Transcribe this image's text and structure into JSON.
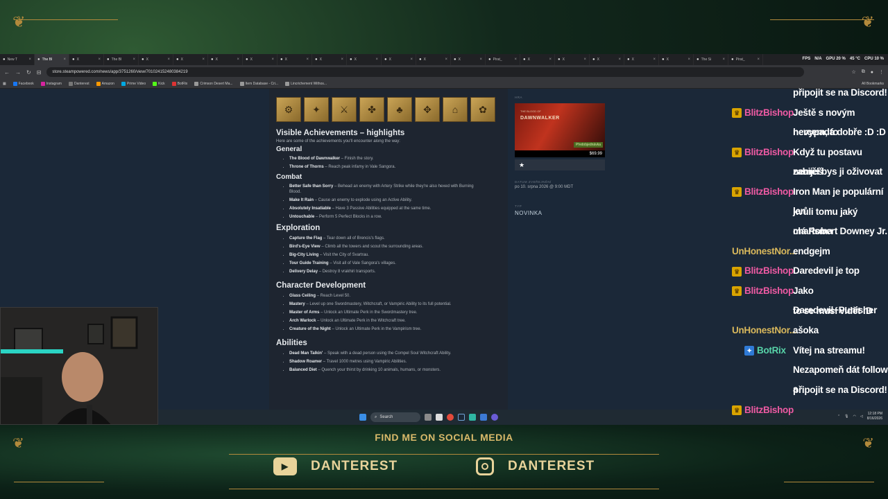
{
  "browser": {
    "tabs": [
      {
        "label": "New T"
      },
      {
        "label": "The Bl",
        "active": true
      },
      {
        "label": "X"
      },
      {
        "label": "The Bl"
      },
      {
        "label": "X"
      },
      {
        "label": "X"
      },
      {
        "label": "X"
      },
      {
        "label": "X"
      },
      {
        "label": "X"
      },
      {
        "label": "X"
      },
      {
        "label": "X"
      },
      {
        "label": "X"
      },
      {
        "label": "X"
      },
      {
        "label": "X"
      },
      {
        "label": "Pirat_"
      },
      {
        "label": "X"
      },
      {
        "label": "X"
      },
      {
        "label": "X"
      },
      {
        "label": "X"
      },
      {
        "label": "X"
      },
      {
        "label": "The Si"
      },
      {
        "label": "Pirat_"
      }
    ],
    "overlay_stats": {
      "fps_label": "FPS",
      "fps_value": "N/A",
      "gpu": "GPU 20 %",
      "gpu_temp": "45 °C",
      "cpu": "CPU 10 %"
    },
    "url": "store.steampowered.com/news/app/3751260/view/701024152480384219",
    "bookmarks": [
      "Facebook",
      "Instagram",
      "Danterest",
      "Amazon",
      "Prime Video",
      "Kick",
      "BotRix",
      "Crimson Desert Ma...",
      "Item Database - Cri...",
      "Lincrichement Withos..."
    ],
    "all_bookmarks": "All Bookmarks"
  },
  "article": {
    "badge_icons": [
      "⚙",
      "✦",
      "⚔",
      "✤",
      "♣",
      "✥",
      "⌂",
      "✿"
    ],
    "heading": "Visible Achievements – highlights",
    "intro": "Here are some of the achievements you'll encounter along the way:",
    "sections": [
      {
        "title": "General",
        "style": "h3",
        "items": [
          {
            "name": "The Blood of Dawnwalker",
            "desc": " – Finish the story."
          },
          {
            "name": "Throne of Thorns",
            "desc": " – Reach peak infamy in Vale Sangora."
          }
        ]
      },
      {
        "title": "Combat",
        "style": "h3",
        "items": [
          {
            "name": "Better Safe than Sorry",
            "desc": " – Behead an enemy with Artery Strike while they're also hexed with Burning"
          },
          {
            "name": "",
            "desc": "Blood.",
            "cont": true
          },
          {
            "name": "Make It Rain",
            "desc": " – Cause an enemy to explode using an Active Ability."
          },
          {
            "name": "Absolutely Insatiable",
            "desc": " – Have 3 Passive Abilities equipped at the same time."
          },
          {
            "name": "Untouchable",
            "desc": " – Perform 5 Perfect Blocks in a row."
          }
        ]
      },
      {
        "title": "Exploration",
        "style": "h2",
        "items": [
          {
            "name": "Capture the Flag",
            "desc": " – Tear down all of Brencis's flags."
          },
          {
            "name": "Bird's-Eye View",
            "desc": " – Climb all the towers and scout the surrounding areas."
          },
          {
            "name": "Big-City Living",
            "desc": " – Visit the City of Svartrau."
          },
          {
            "name": "Tour Guide Training",
            "desc": " – Visit all of Vale Sangora's villages."
          },
          {
            "name": "Delivery Delay",
            "desc": " – Destroy 8 vrakhiri transports."
          }
        ]
      },
      {
        "title": "Character Development",
        "style": "h2",
        "items": [
          {
            "name": "Glass Ceiling",
            "desc": " – Reach Level 50."
          },
          {
            "name": "Mastery",
            "desc": " – Level up one Swordmastery, Witchcraft, or Vampiric Ability to its full potential."
          },
          {
            "name": "Master of Arms",
            "desc": " – Unlock an Ultimate Perk in the Swordmastery tree."
          },
          {
            "name": "Arch Warlock",
            "desc": " – Unlock an Ultimate Perk in the Witchcraft tree."
          },
          {
            "name": "Creature of the Night",
            "desc": " – Unlock an Ultimate Perk in the Vampirism tree."
          }
        ]
      },
      {
        "title": "Abilities",
        "style": "h2",
        "items": [
          {
            "name": "Dead Man Talkin'",
            "desc": " – Speak with a dead person using the Compel Soul Witchcraft Ability."
          },
          {
            "name": "Shadow Roamer",
            "desc": " – Travel 1000 metres using Vampiric Abilities."
          },
          {
            "name": "Balanced Diet",
            "desc": " – Quench your thirst by drinking 10 animals, humans, or monsters."
          }
        ]
      }
    ]
  },
  "sidebar": {
    "game_label": "HRA",
    "cover_subtitle": "THE BLOOD OF",
    "cover_title": "DAWNWALKER",
    "preorder": "Předobjednávka",
    "price": "$69.99",
    "star": "★",
    "date_label": "DATUM ZVEŘEJNĚNÍ",
    "date_value": "po 10. srpna 2026 @ 9:00 MDT",
    "type_label": "TYP",
    "type_value": "NOVINKA"
  },
  "taskbar": {
    "search": "Search",
    "time": "12:18 PM",
    "date": "8/16/2026"
  },
  "chat": [
    {
      "user": "",
      "text": "připojit se na Discord!",
      "type": "cont"
    },
    {
      "user": "BlitzBishop",
      "text": "Ještě s novým hercem, to",
      "type": "sub"
    },
    {
      "user": "",
      "text": "nevypadá dobře :D :D",
      "type": "cont"
    },
    {
      "user": "BlitzBishop",
      "text": "Když tu postavu zabiješ",
      "type": "sub"
    },
    {
      "user": "",
      "text": "neměl bys ji oživovat",
      "type": "cont"
    },
    {
      "user": "BlitzBishop",
      "text": "Iron Man je populární jen",
      "type": "sub"
    },
    {
      "user": "",
      "text": "kvůli tomu jaký charisma",
      "type": "cont"
    },
    {
      "user": "",
      "text": "má Robert Downey Jr.",
      "type": "cont"
    },
    {
      "user": "UnHonestNor...",
      "text": "endgejm",
      "type": "alt"
    },
    {
      "user": "BlitzBishop",
      "text": "Daredevil je top",
      "type": "sub"
    },
    {
      "user": "BlitzBishop",
      "text": "Jako Daredevil+Punisher",
      "type": "sub"
    },
    {
      "user": "",
      "text": "to se musí vidět :D",
      "type": "cont"
    },
    {
      "user": "UnHonestNor...",
      "text": "ašoka",
      "type": "alt"
    },
    {
      "user": "BotRix",
      "text": "Vítej na streamu!",
      "type": "bot"
    },
    {
      "user": "",
      "text": "Nezapomeň dát follow a",
      "type": "cont"
    },
    {
      "user": "",
      "text": "připojit se na Discord!",
      "type": "cont"
    },
    {
      "user": "BlitzBishop",
      "text": "",
      "type": "sub"
    }
  ],
  "banner": {
    "title": "FIND ME ON SOCIAL MEDIA",
    "youtube": "DANTEREST",
    "instagram": "DANTEREST"
  },
  "colors": {
    "steam_bg": "#1b2838",
    "gold": "#d9b96a",
    "chat_user": "#ee5aa3"
  }
}
